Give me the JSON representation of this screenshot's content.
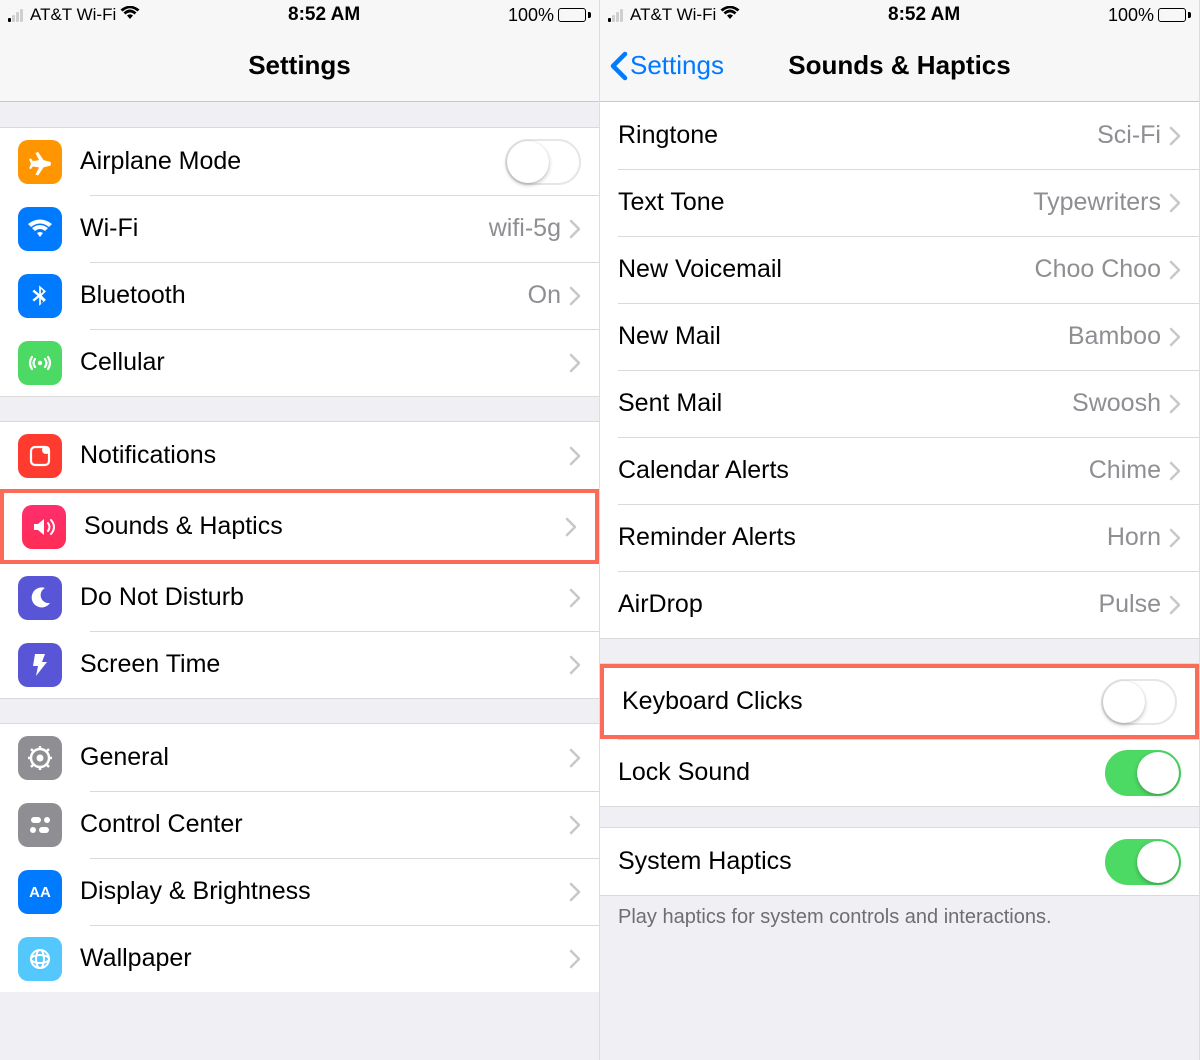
{
  "status": {
    "carrier": "AT&T Wi-Fi",
    "time": "8:52 AM",
    "battery_pct": "100%"
  },
  "left": {
    "title": "Settings",
    "rows": {
      "airplane": "Airplane Mode",
      "wifi": "Wi-Fi",
      "wifi_value": "wifi-5g",
      "bluetooth": "Bluetooth",
      "bluetooth_value": "On",
      "cellular": "Cellular",
      "notifications": "Notifications",
      "sounds": "Sounds & Haptics",
      "dnd": "Do Not Disturb",
      "screentime": "Screen Time",
      "general": "General",
      "controlcenter": "Control Center",
      "display": "Display & Brightness",
      "wallpaper": "Wallpaper"
    }
  },
  "right": {
    "back": "Settings",
    "title": "Sounds & Haptics",
    "rows": {
      "ringtone": "Ringtone",
      "ringtone_v": "Sci-Fi",
      "texttone": "Text Tone",
      "texttone_v": "Typewriters",
      "voicemail": "New Voicemail",
      "voicemail_v": "Choo Choo",
      "newmail": "New Mail",
      "newmail_v": "Bamboo",
      "sentmail": "Sent Mail",
      "sentmail_v": "Swoosh",
      "calendar": "Calendar Alerts",
      "calendar_v": "Chime",
      "reminder": "Reminder Alerts",
      "reminder_v": "Horn",
      "airdrop": "AirDrop",
      "airdrop_v": "Pulse",
      "keyboard": "Keyboard Clicks",
      "locksound": "Lock Sound",
      "systemhaptics": "System Haptics"
    },
    "footer": "Play haptics for system controls and interactions."
  }
}
